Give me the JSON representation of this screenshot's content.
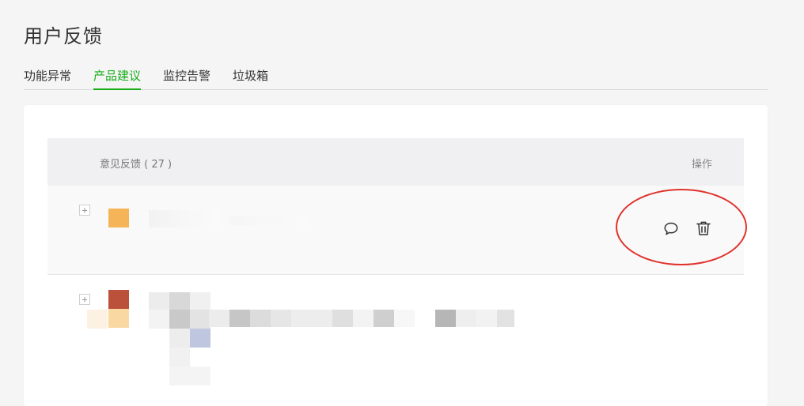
{
  "page": {
    "title": "用户反馈"
  },
  "tabs": [
    {
      "label": "功能异常",
      "active": false
    },
    {
      "label": "产品建议",
      "active": true
    },
    {
      "label": "监控告警",
      "active": false
    },
    {
      "label": "垃圾箱",
      "active": false
    }
  ],
  "table": {
    "columns": {
      "feedback": "意见反馈 ( 27 )",
      "actions": "操作"
    },
    "rows": [
      {
        "expand_symbol": "+",
        "actions": [
          "comment-icon",
          "trash-icon"
        ]
      },
      {
        "expand_symbol": "+"
      }
    ]
  },
  "colors": {
    "accent": "#1aad19",
    "annotation": "#e0322b",
    "avatar_row1": "#f5b458",
    "avatar_row2_top": "#bb513b",
    "avatar_row2_bottom": "#f9d8a2"
  }
}
